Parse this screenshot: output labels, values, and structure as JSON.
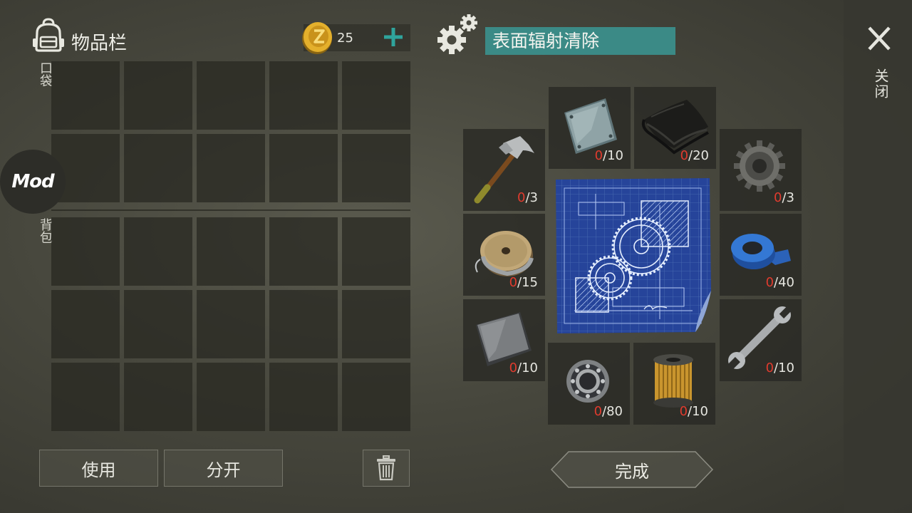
{
  "inventory": {
    "title": "物品栏",
    "pocket_label": "口袋",
    "backpack_label": "背包",
    "coins": "25",
    "use_button": "使用",
    "split_button": "分开",
    "mod_badge": "Mod"
  },
  "crafting": {
    "recipe_name": "表面辐射清除",
    "done_button": "完成",
    "ingredients": [
      {
        "name": "metal-plate",
        "have": "0",
        "need": "/10"
      },
      {
        "name": "leather",
        "have": "0",
        "need": "/20"
      },
      {
        "name": "hammer",
        "have": "0",
        "need": "/3"
      },
      {
        "name": "gear",
        "have": "0",
        "need": "/3"
      },
      {
        "name": "wire-spool",
        "have": "0",
        "need": "/15"
      },
      {
        "name": "blue-tape",
        "have": "0",
        "need": "/40"
      },
      {
        "name": "sheet-metal",
        "have": "0",
        "need": "/10"
      },
      {
        "name": "wrench",
        "have": "0",
        "need": "/10"
      },
      {
        "name": "bearing",
        "have": "0",
        "need": "/80"
      },
      {
        "name": "oil-filter",
        "have": "0",
        "need": "/10"
      }
    ]
  },
  "side": {
    "close_label": "关闭"
  },
  "colors": {
    "accent_teal": "#3b8a86",
    "missing_red": "#e03b2e",
    "add_teal": "#2fa49c"
  },
  "icons": [
    "backpack-icon",
    "coin-icon",
    "plus-icon",
    "gears-icon",
    "close-icon",
    "trash-icon"
  ]
}
